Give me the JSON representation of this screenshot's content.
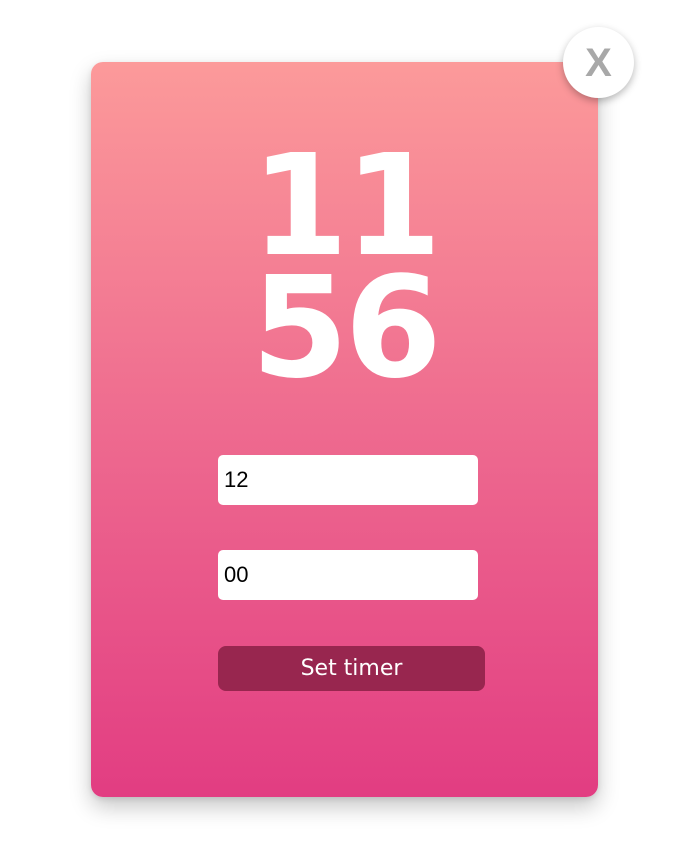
{
  "timer": {
    "display_hours": "11",
    "display_minutes": "56",
    "hours_input_value": "12",
    "minutes_input_value": "00",
    "set_button_label": "Set timer"
  },
  "close": {
    "label": "X",
    "icon": "close-icon"
  },
  "colors": {
    "gradient_top": "#fc9a9a",
    "gradient_bottom": "#e23d82",
    "button_bg": "#98264f",
    "close_icon": "#a8a8a8"
  }
}
